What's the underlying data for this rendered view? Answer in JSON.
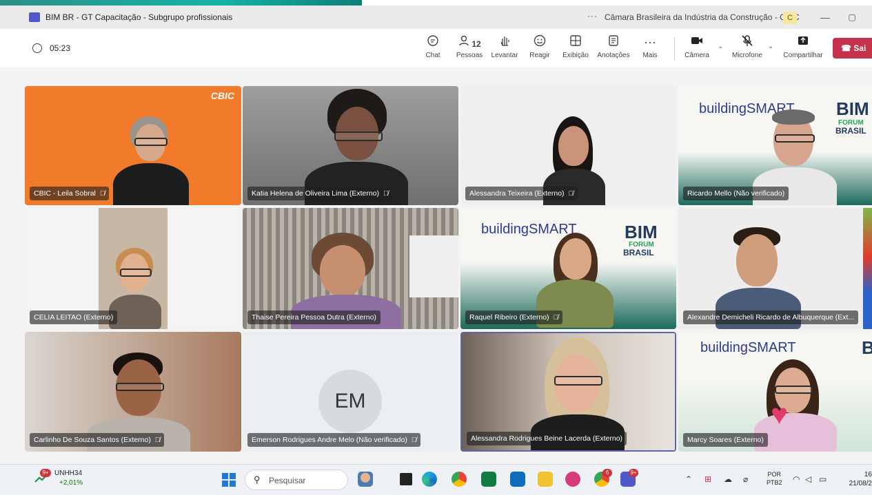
{
  "window": {
    "title": "BIM BR - GT Capacitação - Subgrupo profissionais",
    "more": "···",
    "org": "Câmara Brasileira da Indústria da Construção - CBIC",
    "org_badge": "C",
    "minimize": "—",
    "maximize": "▢"
  },
  "toolbar": {
    "timer": "05:23",
    "chat_label": "Chat",
    "people_label": "Pessoas",
    "people_count": "12",
    "raise_label": "Levantar",
    "react_label": "Reagir",
    "view_label": "Exibição",
    "notes_label": "Anotações",
    "more_label": "Mais",
    "camera_label": "Câmera",
    "mic_label": "Microfone",
    "share_label": "Compartilhar",
    "leave_label": "Sai",
    "icons": {
      "chat": "chat-bubble-icon",
      "people": "people-icon",
      "raise": "raise-hand-icon",
      "react": "smiley-icon",
      "view": "grid-view-icon",
      "notes": "notes-icon",
      "more": "ellipsis-icon",
      "camera": "camera-icon",
      "mic": "mic-off-icon",
      "share": "share-up-icon",
      "leave": "phone-hangup-icon"
    }
  },
  "tiles": {
    "t1": {
      "name": "CBIC - Leila Sobral",
      "logo": "CBIC"
    },
    "t2": {
      "name": "Katia Helena de Oliveira Lima (Externo)"
    },
    "t3": {
      "name": "Alessandra Teixeira (Externo)"
    },
    "t4": {
      "name": "Ricardo Mello (Não verificado)"
    },
    "t5": {
      "name": "CELIA LEITAO (Externo)"
    },
    "t6": {
      "name": "Thaise Pereira Pessoa Dutra (Externo)"
    },
    "t7": {
      "name": "Raquel Ribeiro (Externo)"
    },
    "t8": {
      "name": "Alexandre Demicheli Ricardo de Albuquerque (Ext..."
    },
    "t9": {
      "name": "Carlinho De Souza Santos (Externo)"
    },
    "t10": {
      "name": "Emerson Rodrigues Andre Melo (Não verificado)",
      "initials": "EM"
    },
    "t11": {
      "name": "Alessandra Rodrigues Beine Lacerda (Externo)"
    },
    "t12": {
      "name": "Marcy Soares (Externo)"
    }
  },
  "backgrounds": {
    "building_smart": "buildingSMART",
    "brasil": "Brasil",
    "bim": "BIM",
    "forum": "FORUM",
    "bim_brasil": "BRASIL"
  },
  "mute_glyph": "🎙̸",
  "taskbar": {
    "ticker": "UNHH34",
    "change": "+2,01%",
    "weather_badge": "9+",
    "search_placeholder": "Pesquisar",
    "teams_badge": "9+",
    "chrome_badge": "6",
    "lang_top": "POR",
    "lang_bottom": "PTB2",
    "time": "16",
    "date": "21/08/2",
    "colors": {
      "accent": "#1e79d8",
      "leave": "#c4314b",
      "tile_orange": "#f27b2b"
    }
  }
}
